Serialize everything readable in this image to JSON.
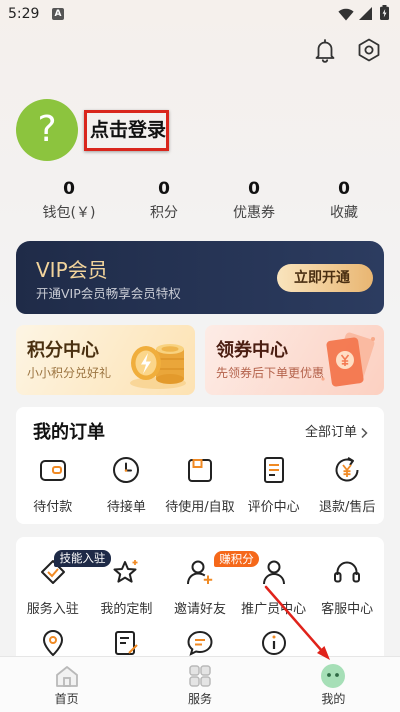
{
  "status_bar": {
    "time": "5:29",
    "notification_badge": "A",
    "icons": [
      "notification-a-icon",
      "wifi-icon",
      "signal-icon",
      "battery-icon"
    ]
  },
  "header": {
    "icons": [
      "bell-icon",
      "settings-icon"
    ]
  },
  "profile": {
    "avatar_text": "?",
    "login_label": "点击登录"
  },
  "stats": [
    {
      "value": "0",
      "label": "钱包(￥)"
    },
    {
      "value": "0",
      "label": "积分"
    },
    {
      "value": "0",
      "label": "优惠券"
    },
    {
      "value": "0",
      "label": "收藏"
    }
  ],
  "vip": {
    "title": "VIP会员",
    "subtitle": "开通VIP会员畅享会员特权",
    "button_label": "立即开通"
  },
  "promo_cards": [
    {
      "title": "积分中心",
      "subtitle": "小小积分兑好礼",
      "icon": "coins-icon"
    },
    {
      "title": "领券中心",
      "subtitle": "先领券后下单更优惠",
      "icon": "coupon-icon"
    }
  ],
  "orders": {
    "title": "我的订单",
    "all_link": "全部订单",
    "items": [
      {
        "label": "待付款",
        "icon": "wallet-icon"
      },
      {
        "label": "待接单",
        "icon": "clock-icon"
      },
      {
        "label": "待使用/自取",
        "icon": "package-icon"
      },
      {
        "label": "评价中心",
        "icon": "review-icon"
      },
      {
        "label": "退款/售后",
        "icon": "refund-icon"
      }
    ]
  },
  "services": {
    "items": [
      {
        "label": "服务入驻",
        "icon": "badge-check-icon",
        "tag": "技能入驻"
      },
      {
        "label": "我的定制",
        "icon": "star-icon"
      },
      {
        "label": "邀请好友",
        "icon": "add-user-icon",
        "tag": "赚积分"
      },
      {
        "label": "推广员中心",
        "icon": "promoter-icon"
      },
      {
        "label": "客服中心",
        "icon": "headset-icon"
      }
    ],
    "more_icons": [
      "location-icon",
      "edit-list-icon",
      "chat-icon",
      "info-icon"
    ]
  },
  "bottom_nav": {
    "items": [
      {
        "label": "首页",
        "icon": "home-icon",
        "active": false
      },
      {
        "label": "服务",
        "icon": "grid-icon",
        "active": false
      },
      {
        "label": "我的",
        "icon": "profile-face-icon",
        "active": true
      }
    ]
  },
  "colors": {
    "page_bg": "#f3f3f3",
    "vip_background": "#1f2b48",
    "vip_gold": "#f2d49c",
    "accent_orange": "#f08a24",
    "avatar_green": "#8cc43e",
    "annotation_red": "#d9261c",
    "skill_tag": "#1e2a47",
    "points_tag": "#f5681a"
  }
}
